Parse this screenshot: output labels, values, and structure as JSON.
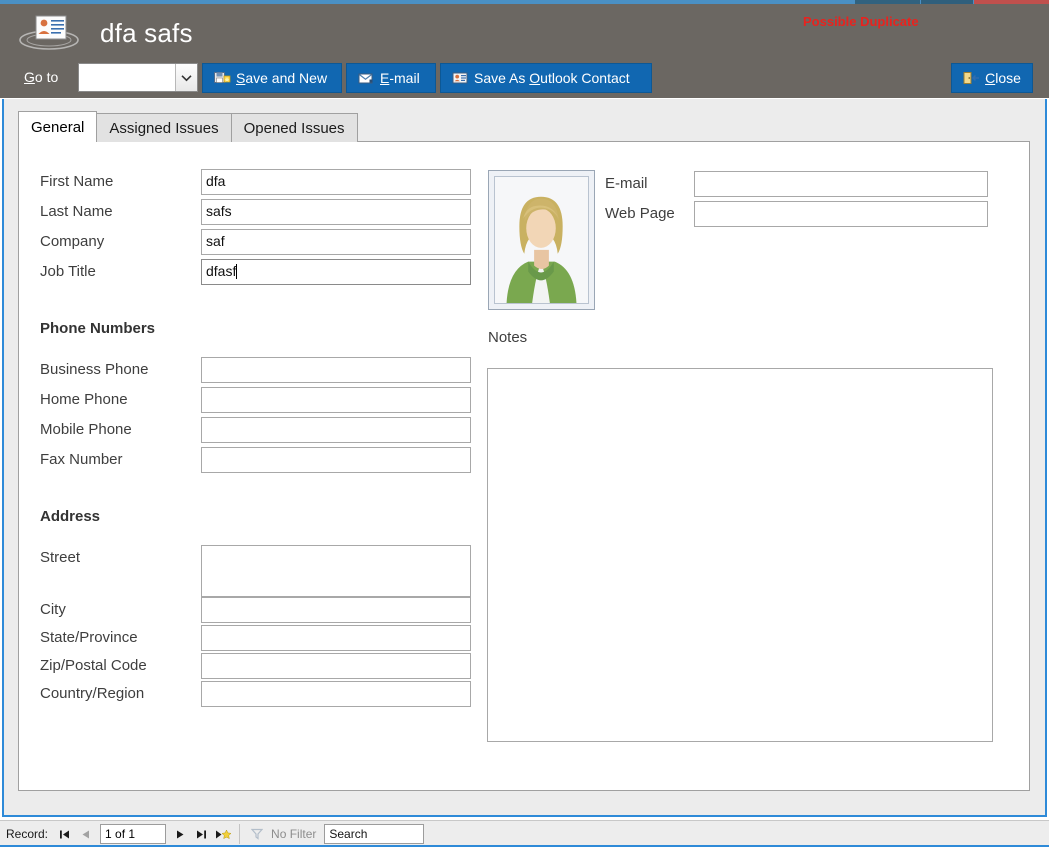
{
  "window": {
    "title": "dfa safs",
    "icon": "contact-card-icon",
    "duplicate_warning": "Possible Duplicate",
    "warning_color": "#e8231f",
    "header_bg": "#6b6762",
    "accent_blue": "#1167b1",
    "border_blue": "#2e8ad8"
  },
  "toolbar": {
    "goto_label_pre": "G",
    "goto_label_post": "o to",
    "goto_value": "",
    "goto_icon": "chevron-down-icon",
    "buttons": [
      {
        "id": "save-and-new",
        "pre": "Save and New",
        "accel_char": "S",
        "label_before": "",
        "label_accel": "S",
        "label_after": "ave and New",
        "icon": "save-new-icon"
      },
      {
        "id": "email",
        "label_before": "",
        "label_accel": "E",
        "label_after": "-mail",
        "icon": "envelope-icon"
      },
      {
        "id": "save-as-outlook-contact",
        "label_before": "Save As ",
        "label_accel": "O",
        "label_after": "utlook Contact",
        "icon": "outlook-contact-icon"
      },
      {
        "id": "close",
        "label_before": "",
        "label_accel": "C",
        "label_after": "lose",
        "icon": "close-door-icon"
      }
    ]
  },
  "tabs": [
    {
      "id": "general",
      "label": "General",
      "active": true
    },
    {
      "id": "assigned-issues",
      "label": "Assigned Issues",
      "active": false
    },
    {
      "id": "opened-issues",
      "label": "Opened Issues",
      "active": false
    }
  ],
  "general": {
    "identity_fields": [
      {
        "id": "first-name",
        "label": "First Name",
        "value": "dfa",
        "focused": false
      },
      {
        "id": "last-name",
        "label": "Last Name",
        "value": "safs",
        "focused": false
      },
      {
        "id": "company",
        "label": "Company",
        "value": "saf",
        "focused": false
      },
      {
        "id": "job-title",
        "label": "Job Title",
        "value": "dfasf",
        "focused": true
      }
    ],
    "phone_section": {
      "heading": "Phone Numbers",
      "fields": [
        {
          "id": "business-phone",
          "label": "Business Phone",
          "value": ""
        },
        {
          "id": "home-phone",
          "label": "Home Phone",
          "value": ""
        },
        {
          "id": "mobile-phone",
          "label": "Mobile Phone",
          "value": ""
        },
        {
          "id": "fax-number",
          "label": "Fax Number",
          "value": ""
        }
      ]
    },
    "address_section": {
      "heading": "Address",
      "fields": [
        {
          "id": "street",
          "label": "Street",
          "value": "",
          "multiline": true
        },
        {
          "id": "city",
          "label": "City",
          "value": ""
        },
        {
          "id": "state-province",
          "label": "State/Province",
          "value": ""
        },
        {
          "id": "zip-postal-code",
          "label": "Zip/Postal Code",
          "value": ""
        },
        {
          "id": "country-region",
          "label": "Country/Region",
          "value": ""
        }
      ]
    },
    "contact_fields": [
      {
        "id": "e-mail",
        "label": "E-mail",
        "value": ""
      },
      {
        "id": "web-page",
        "label": "Web Page",
        "value": ""
      }
    ],
    "photo": {
      "label": "contact-photo",
      "alt": "generic contact portrait"
    },
    "notes": {
      "label": "Notes",
      "value": ""
    }
  },
  "statusbar": {
    "record_label": "Record:",
    "record_position": "1 of 1",
    "first_icon": "first-record-icon",
    "prev_icon": "previous-record-icon",
    "next_icon": "next-record-icon",
    "last_icon": "last-record-icon",
    "new_icon": "new-record-icon",
    "filter_icon": "filter-icon",
    "filter_text": "No Filter",
    "search_value": "Search"
  }
}
